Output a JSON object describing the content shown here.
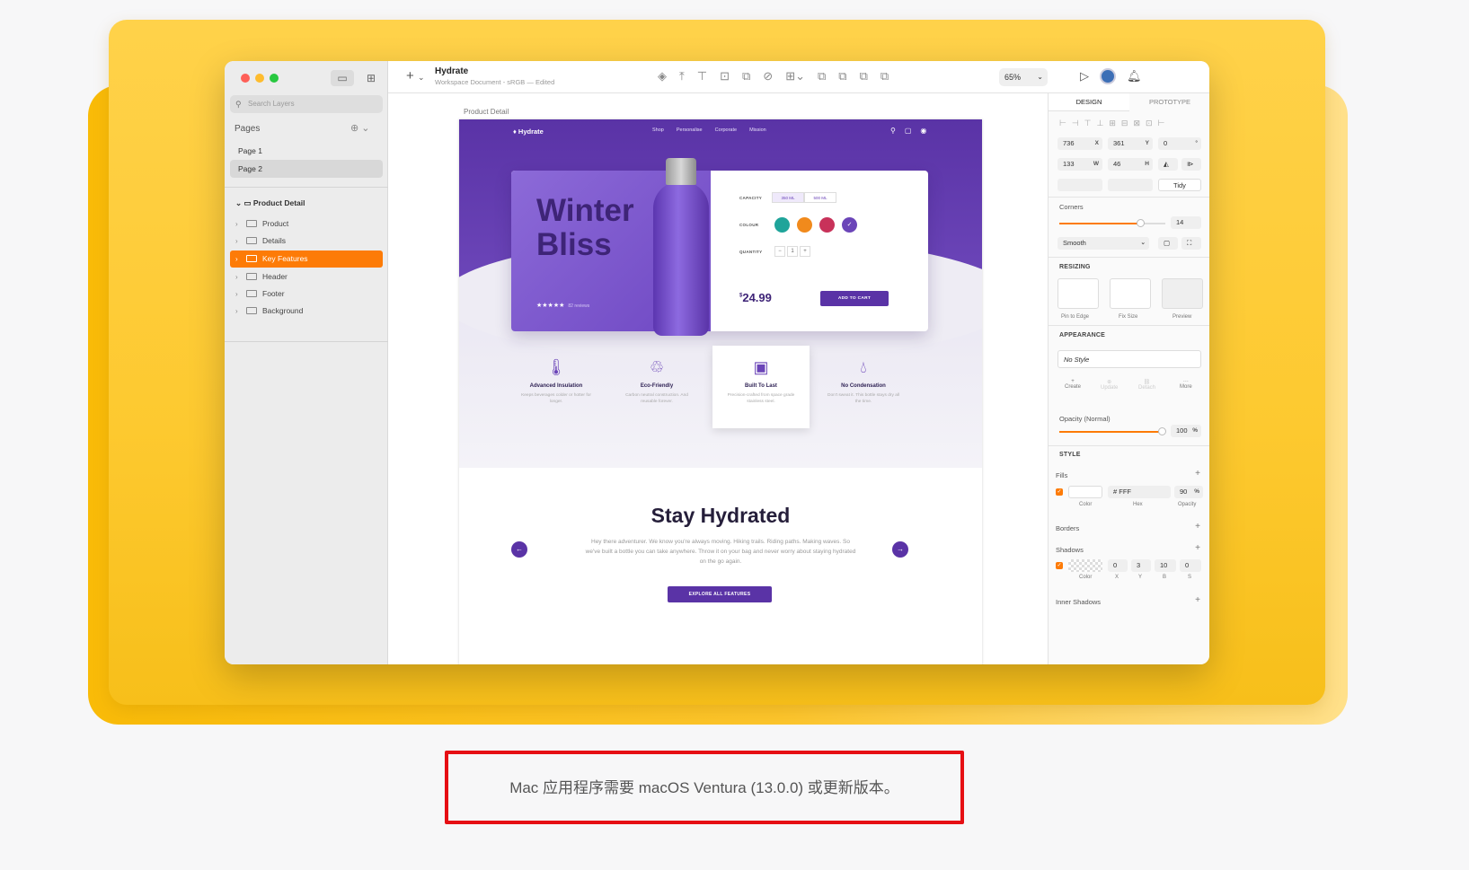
{
  "window": {
    "doc_title": "Hydrate",
    "doc_subtitle": "Workspace Document - sRGB — Edited",
    "zoom": "65%"
  },
  "sidebar": {
    "search_placeholder": "Search Layers",
    "pages_label": "Pages",
    "pages": [
      {
        "label": "Page 1"
      },
      {
        "label": "Page 2"
      }
    ],
    "artboard": "Product Detail",
    "layers": [
      {
        "label": "Product"
      },
      {
        "label": "Details"
      },
      {
        "label": "Key Features"
      },
      {
        "label": "Header"
      },
      {
        "label": "Footer"
      },
      {
        "label": "Background"
      }
    ]
  },
  "canvas": {
    "artboard_label": "Product Detail",
    "site": {
      "logo": "Hydrate",
      "nav": [
        "Shop",
        "Personalise",
        "Corporate",
        "Mission"
      ],
      "hero_title": "Winter Bliss",
      "reviews": "82 reviews",
      "capacity_label": "CAPACITY",
      "capacity_options": [
        "350 ML",
        "500 ML"
      ],
      "colour_label": "COLOUR",
      "colours": [
        "#1fa49a",
        "#f18a1c",
        "#c8325a",
        "#6b45b8"
      ],
      "quantity_label": "QUANTITY",
      "quantity_value": "1",
      "price_currency": "$",
      "price": "24.99",
      "cart_button": "ADD TO CART",
      "features": [
        {
          "title": "Advanced Insulation",
          "desc": "Keeps beverages colder or hotter for longer."
        },
        {
          "title": "Eco-Friendly",
          "desc": "Carbon neutral construction. And reusable forever."
        },
        {
          "title": "Built To Last",
          "desc": "Precision-crafted from space grade stainless steel."
        },
        {
          "title": "No Condensation",
          "desc": "Don't sweat it. This bottle stays dry all the time."
        }
      ],
      "section_title": "Stay Hydrated",
      "section_desc": "Hey there adventurer. We know you're always moving. Hiking trails. Riding paths. Making waves. So we've built a bottle you can take anywhere. Throw it on your bag and never worry about staying hydrated on the go again.",
      "explore_button": "EXPLORE ALL FEATURES"
    }
  },
  "inspector": {
    "tabs": [
      "DESIGN",
      "PROTOTYPE"
    ],
    "x": "736",
    "y": "361",
    "rotation": "0",
    "w": "133",
    "h": "46",
    "tidy": "Tidy",
    "corners_label": "Corners",
    "corner_value": "14",
    "corner_style": "Smooth",
    "resizing_label": "RESIZING",
    "resizing_options": [
      "Pin to Edge",
      "Fix Size",
      "Preview"
    ],
    "appearance_label": "APPEARANCE",
    "style_value": "No Style",
    "style_actions": [
      "Create",
      "Update",
      "Detach",
      "More"
    ],
    "opacity_label": "Opacity (Normal)",
    "opacity_value": "100",
    "style_label": "STYLE",
    "fills_label": "Fills",
    "fill_hex": "FFF",
    "fill_opacity": "90",
    "fill_cols": [
      "Color",
      "Hex",
      "Opacity"
    ],
    "borders_label": "Borders",
    "shadows_label": "Shadows",
    "shadow_vals": [
      "0",
      "3",
      "10",
      "0"
    ],
    "shadow_cols": [
      "Color",
      "X",
      "Y",
      "B",
      "S"
    ],
    "inner_shadows_label": "Inner Shadows"
  },
  "footer": {
    "note": "Mac 应用程序需要 macOS Ventura (13.0.0) 或更新版本。"
  },
  "colors": {
    "accent": "#fd7b07",
    "brand_purple": "#5a33a6",
    "highlight_box": "#e60f14"
  }
}
